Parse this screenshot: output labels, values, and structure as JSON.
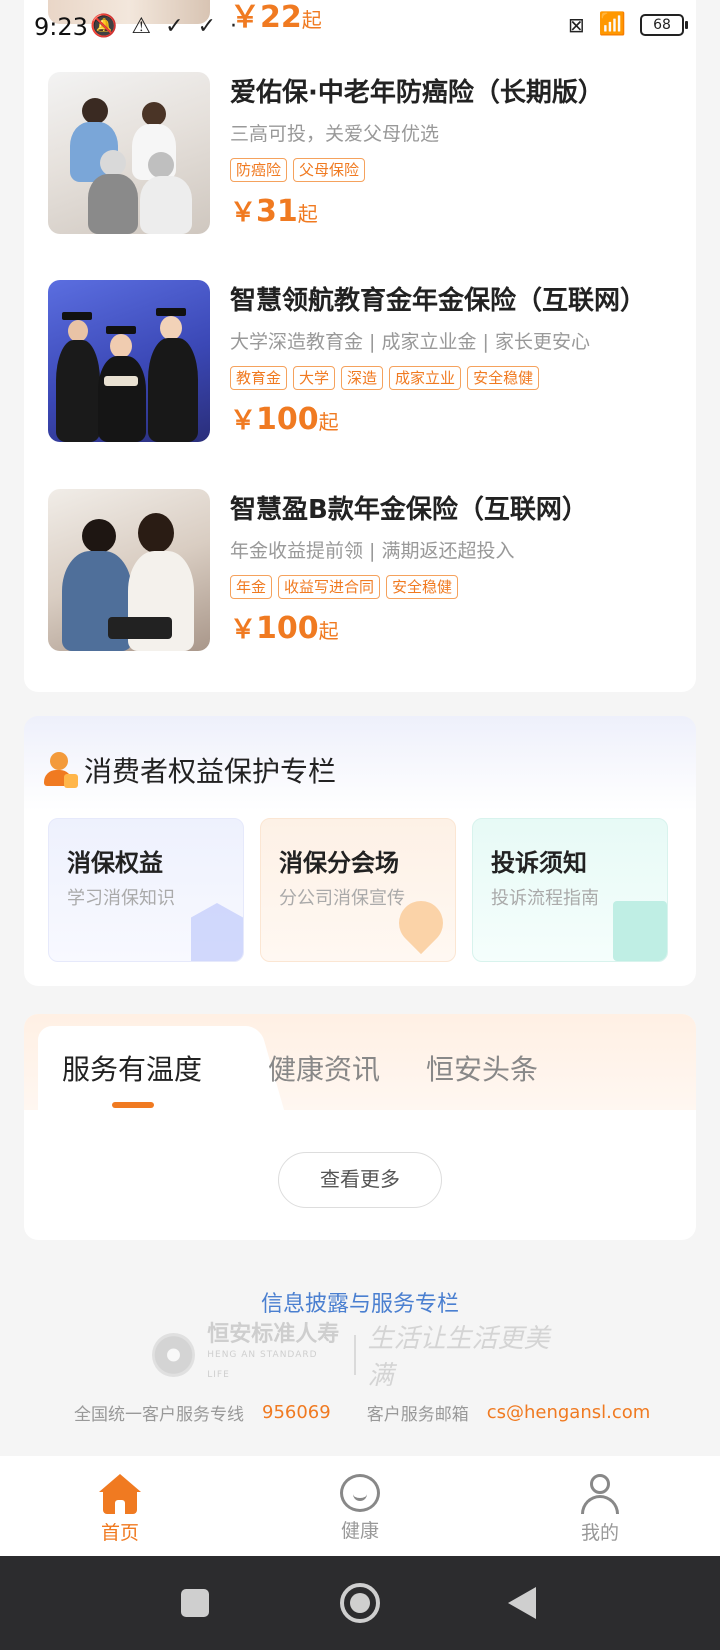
{
  "status_bar": {
    "time": "9:23",
    "left_icons": [
      "bell-off-icon",
      "warning-icon",
      "check-icon",
      "check-icon",
      "dot-icon"
    ],
    "battery": "68"
  },
  "partial_product": {
    "price_prefix": "￥",
    "price": "22",
    "price_suffix": "起"
  },
  "products": [
    {
      "title": "爱佑保·中老年防癌险（长期版）",
      "subtitle": "三高可投，关爱父母优选",
      "tags": [
        "防癌险",
        "父母保险"
      ],
      "price_prefix": "￥",
      "price": "31",
      "price_suffix": "起"
    },
    {
      "title": "智慧领航教育金年金保险（互联网）",
      "subtitle": "大学深造教育金 | 成家立业金 | 家长更安心",
      "tags": [
        "教育金",
        "大学",
        "深造",
        "成家立业",
        "安全稳健"
      ],
      "price_prefix": "￥",
      "price": "100",
      "price_suffix": "起"
    },
    {
      "title": "智慧盈B款年金保险（互联网）",
      "subtitle": "年金收益提前领 | 满期返还超投入",
      "tags": [
        "年金",
        "收益写进合同",
        "安全稳健"
      ],
      "price_prefix": "￥",
      "price": "100",
      "price_suffix": "起"
    }
  ],
  "rights": {
    "title": "消费者权益保护专栏",
    "tiles": [
      {
        "title": "消保权益",
        "subtitle": "学习消保知识",
        "icon": "shield-check-icon"
      },
      {
        "title": "消保分会场",
        "subtitle": "分公司消保宣传",
        "icon": "location-pin-icon"
      },
      {
        "title": "投诉须知",
        "subtitle": "投诉流程指南",
        "icon": "document-icon"
      }
    ]
  },
  "service": {
    "tabs": [
      "服务有温度",
      "健康资讯",
      "恒安头条"
    ],
    "active_tab": 0,
    "more_label": "查看更多"
  },
  "footer": {
    "disclosure": "信息披露与服务专栏",
    "logo_text": "恒安标准人寿",
    "logo_sub": "HENG AN STANDARD LIFE",
    "slogan": "生活让生活更美满",
    "hotline_label": "全国统一客户服务专线",
    "hotline": "956069",
    "email_label": "客户服务邮箱",
    "email": "cs@hengansl.com"
  },
  "bottom_nav": [
    {
      "label": "首页",
      "icon": "home-icon",
      "active": true
    },
    {
      "label": "健康",
      "icon": "heart-icon",
      "active": false
    },
    {
      "label": "我的",
      "icon": "user-icon",
      "active": false
    }
  ],
  "colors": {
    "accent": "#f07a21",
    "link": "#4a7fd0"
  }
}
